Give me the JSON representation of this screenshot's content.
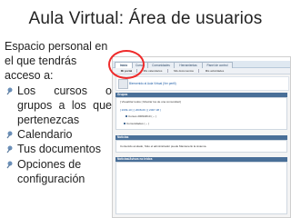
{
  "slide": {
    "title": "Aula Virtual: Área de usuarios",
    "intro_lines": [
      "Espacio personal en",
      "el que tendrás",
      "acceso a:"
    ],
    "bullets": [
      "Los cursos o grupos a los que pertenezcas",
      "Calendario",
      "Tus documentos",
      "Opciones de configuración"
    ]
  },
  "screenshot": {
    "tabs": [
      "Inicio",
      "Cursos",
      "Comunidades",
      "Herramientas",
      "Panel de control"
    ],
    "subtabs": [
      "Mi portal",
      "Mis calendarios",
      "Mis documentos",
      "Mis actividades"
    ],
    "user_text": "Bienvenido al Aula Virtual (Ver perfil)",
    "groups_header": "Grupos",
    "groups_links": "[ Visualizar todos | Mostrar los de una comunidad ]",
    "years_line": "[ 2009-10 ] [ 2008-09 ] [ 2007-08 ]",
    "course_line": "Cursos 2009/2010 ( -- )",
    "community_line": "Comunidades ( -- )",
    "news_header": "Noticias",
    "news_text": "Contenido anulado, Sólo el administrador puede Mantenerlo la sistema.",
    "unread_header": "Noticias/Avisos no leídos"
  },
  "colors": {
    "highlight": "#ef2b2b",
    "panel": "#496f98",
    "link": "#1f5ea8"
  }
}
